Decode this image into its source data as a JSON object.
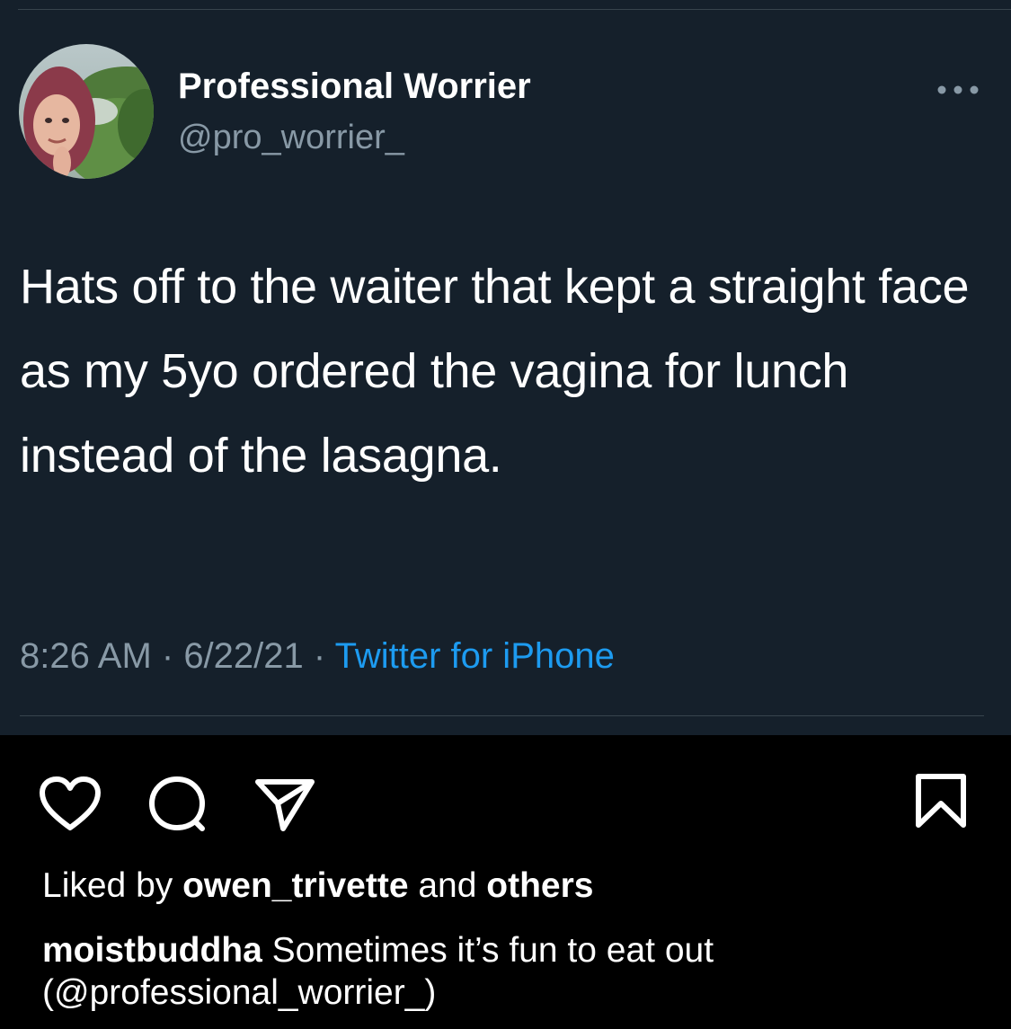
{
  "tweet": {
    "author": {
      "display_name": "Professional Worrier",
      "handle": "@pro_worrier_"
    },
    "menu_icon": "more-dots-icon",
    "text": "Hats off to the waiter that kept a straight face as my 5yo ordered the vagina for lunch instead of the lasagna.",
    "time": "8:26 AM",
    "separator": " · ",
    "date": "6/22/21",
    "source": "Twitter for iPhone",
    "colors": {
      "background": "#15202b",
      "secondary_text": "#8899a6",
      "link": "#1d9bf0"
    }
  },
  "post": {
    "actions": [
      {
        "icon": "heart-icon"
      },
      {
        "icon": "comment-icon"
      },
      {
        "icon": "share-icon"
      },
      {
        "icon": "bookmark-icon"
      }
    ],
    "likes": {
      "prefix": "Liked by ",
      "user": "owen_trivette",
      "middle": " and ",
      "others": "others"
    },
    "caption": {
      "username": "moistbuddha",
      "text": " Sometimes it’s fun to eat out (@professional_worrier_)"
    }
  }
}
